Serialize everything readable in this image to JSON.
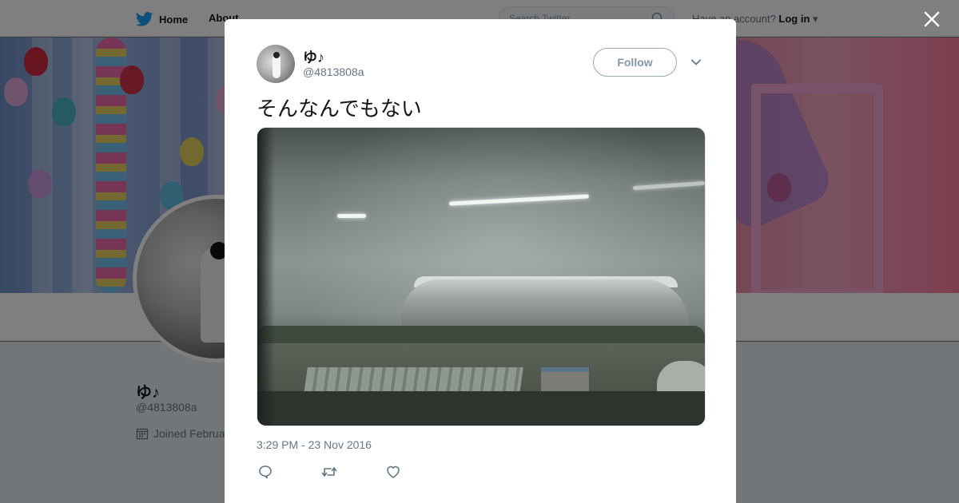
{
  "nav": {
    "home_label": "Home",
    "about_label": "About",
    "search_placeholder": "Search Twitter",
    "account_prompt": "Have an account?",
    "login_label": "Log in"
  },
  "profile": {
    "name": "ゆ♪",
    "handle": "@4813808a",
    "joined": "Joined Februa"
  },
  "tweet": {
    "author_name": "ゆ♪",
    "author_handle": "@4813808a",
    "follow_label": "Follow",
    "text": "そんなんでもない",
    "timestamp": "3:29 PM - 23 Nov 2016"
  },
  "icons": {
    "twitter_logo": "twitter-bird-icon",
    "search": "search-icon",
    "close": "close-icon",
    "caret": "chevron-down-icon",
    "reply": "reply-icon",
    "retweet": "retweet-icon",
    "like": "heart-icon",
    "calendar": "calendar-icon"
  },
  "colors": {
    "brand": "#1da1f2",
    "text_primary": "#14171a",
    "text_secondary": "#657786"
  }
}
